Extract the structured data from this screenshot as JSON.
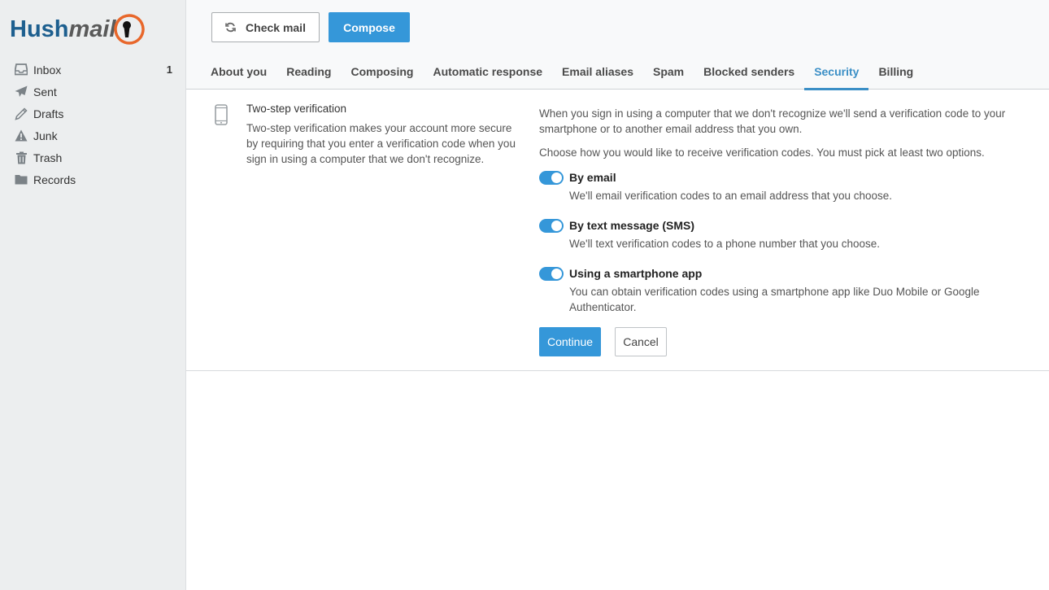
{
  "app": {
    "logo_primary": "Hush",
    "logo_secondary": "mail"
  },
  "sidebar": {
    "folders": [
      {
        "label": "Inbox",
        "icon": "inbox-icon",
        "count": "1"
      },
      {
        "label": "Sent",
        "icon": "paper-plane-icon",
        "count": ""
      },
      {
        "label": "Drafts",
        "icon": "pencil-icon",
        "count": ""
      },
      {
        "label": "Junk",
        "icon": "warning-icon",
        "count": ""
      },
      {
        "label": "Trash",
        "icon": "trash-icon",
        "count": ""
      },
      {
        "label": "Records",
        "icon": "folder-icon",
        "count": ""
      }
    ]
  },
  "toolbar": {
    "check_mail_label": "Check mail",
    "compose_label": "Compose"
  },
  "tabs": [
    {
      "label": "About you",
      "active": false
    },
    {
      "label": "Reading",
      "active": false
    },
    {
      "label": "Composing",
      "active": false
    },
    {
      "label": "Automatic response",
      "active": false
    },
    {
      "label": "Email aliases",
      "active": false
    },
    {
      "label": "Spam",
      "active": false
    },
    {
      "label": "Blocked senders",
      "active": false
    },
    {
      "label": "Security",
      "active": true
    },
    {
      "label": "Billing",
      "active": false
    }
  ],
  "section": {
    "title": "Two-step verification",
    "description": "Two-step verification makes your account more secure by requiring that you enter a verification code when you sign in using a computer that we don't recognize.",
    "intro": "When you sign in using a computer that we don't recognize we'll send a verification code to your smartphone or to another email address that you own.",
    "instruction": "Choose how you would like to receive verification codes. You must pick at least two options.",
    "options": [
      {
        "title": "By email",
        "description": "We'll email verification codes to an email address that you choose.",
        "enabled": true
      },
      {
        "title": "By text message (SMS)",
        "description": "We'll text verification codes to a phone number that you choose.",
        "enabled": true
      },
      {
        "title": "Using a smartphone app",
        "description": "You can obtain verification codes using a smartphone app like Duo Mobile or Google Authenticator.",
        "enabled": true
      }
    ],
    "continue_label": "Continue",
    "cancel_label": "Cancel"
  },
  "colors": {
    "accent": "#3597d9",
    "active_tab": "#3b8fc6",
    "logo_blue": "#1d5f8f",
    "logo_orange": "#e8672b"
  }
}
